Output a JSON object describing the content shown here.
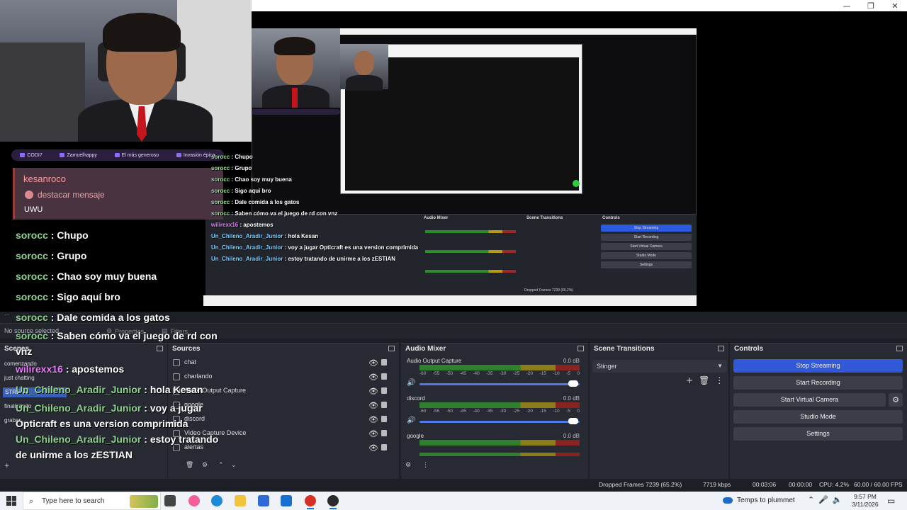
{
  "window": {
    "minimize": "—",
    "restore": "❐",
    "close": "✕"
  },
  "alerts": [
    "CODI7",
    "Zamuelhappy",
    "El más generoso",
    "Invasión épica"
  ],
  "highlight": {
    "user": "kesanroco",
    "action": "destacar mensaje",
    "message": "UWU"
  },
  "chat": [
    {
      "user": "sorocc",
      "color": "green",
      "text": "Chupo"
    },
    {
      "user": "sorocc",
      "color": "green",
      "text": "Grupo"
    },
    {
      "user": "sorocc",
      "color": "green",
      "text": "Chao soy muy buena"
    },
    {
      "user": "sorocc",
      "color": "green",
      "text": "Sigo aquí bro"
    },
    {
      "user": "sorocc",
      "color": "green",
      "text": "Dale comida a los gatos"
    },
    {
      "user": "sorocc",
      "color": "green",
      "text": "Saben cómo va el juego de rd con vnz"
    },
    {
      "user": "wilirexx16",
      "color": "pink",
      "text": "apostemos"
    },
    {
      "user": "Un_Chileno_Aradir_Junior",
      "color": "green",
      "text": "hola Kesan"
    },
    {
      "user": "Un_Chileno_Aradir_Junior",
      "color": "green",
      "text": "voy a jugar Opticraft es una version comprimida"
    },
    {
      "user": "Un_Chileno_Aradir_Junior",
      "color": "green",
      "text": "estoy tratando de unirme a los zESTIAN"
    }
  ],
  "chat_small": [
    {
      "user": "sorocc",
      "text": "Chupo"
    },
    {
      "user": "sorocc",
      "text": "Grupo"
    },
    {
      "user": "sorocc",
      "text": "Chao soy muy buena"
    },
    {
      "user": "sorocc",
      "text": "Sigo aquí bro"
    },
    {
      "user": "sorocc",
      "text": "Dale comida a los gatos"
    },
    {
      "user": "sorocc",
      "text": "Saben cómo va el juego de rd con vnz"
    },
    {
      "user": "wilirexx16",
      "text": "apostemos"
    },
    {
      "user": "Un_Chileno_Aradir_Junior",
      "text": "hola Kesan"
    },
    {
      "user": "Un_Chileno_Aradir_Junior",
      "text": "voy a jugar Opticraft es una version comprimida"
    },
    {
      "user": "Un_Chileno_Aradir_Junior",
      "text": "estoy tratando de unirme a los zESTIAN"
    }
  ],
  "obs": {
    "no_source": "No source selected",
    "properties": "Properties",
    "filters": "Filters",
    "scenes": {
      "title": "Scenes",
      "items": [
        "comenzando",
        "just chatting",
        "STREAM",
        "finalizando",
        "grabar"
      ],
      "selected_index": 2
    },
    "sources": {
      "title": "Sources",
      "items": [
        "chat",
        "charlando",
        "Audio Output Capture",
        "google",
        "discord",
        "Video Capture Device",
        "alertas"
      ]
    },
    "mixer": {
      "title": "Audio Mixer",
      "ticks": [
        "-60",
        "-55",
        "-50",
        "-45",
        "-40",
        "-35",
        "-30",
        "-25",
        "-20",
        "-15",
        "-10",
        "-5",
        "0"
      ],
      "channels": [
        {
          "name": "Audio Output Capture",
          "db": "0.0 dB"
        },
        {
          "name": "discord",
          "db": "0.0 dB"
        },
        {
          "name": "google",
          "db": "0.0 dB"
        }
      ]
    },
    "transitions": {
      "title": "Scene Transitions",
      "selected": "Stinger"
    },
    "controls": {
      "title": "Controls",
      "stop_streaming": "Stop Streaming",
      "start_recording": "Start Recording",
      "start_virtual_camera": "Start Virtual Camera",
      "studio_mode": "Studio Mode",
      "settings": "Settings"
    },
    "status": {
      "dropped_frames": "Dropped Frames 7239 (65.2%)",
      "bitrate": "7719 kbps",
      "stream_time": "00:03:06",
      "rec_time": "00:00:00",
      "cpu": "CPU: 4.2%",
      "fps": "60.00 / 60.00 FPS"
    }
  },
  "taskbar": {
    "search_placeholder": "Type here to search",
    "weather": "Temps to plummet",
    "time": "9:57 PM",
    "date": "3/11/2026"
  },
  "colors": {
    "accent": "#3158d6",
    "chat_user": "#8fd18f",
    "highlight_bg": "#4a3340"
  }
}
